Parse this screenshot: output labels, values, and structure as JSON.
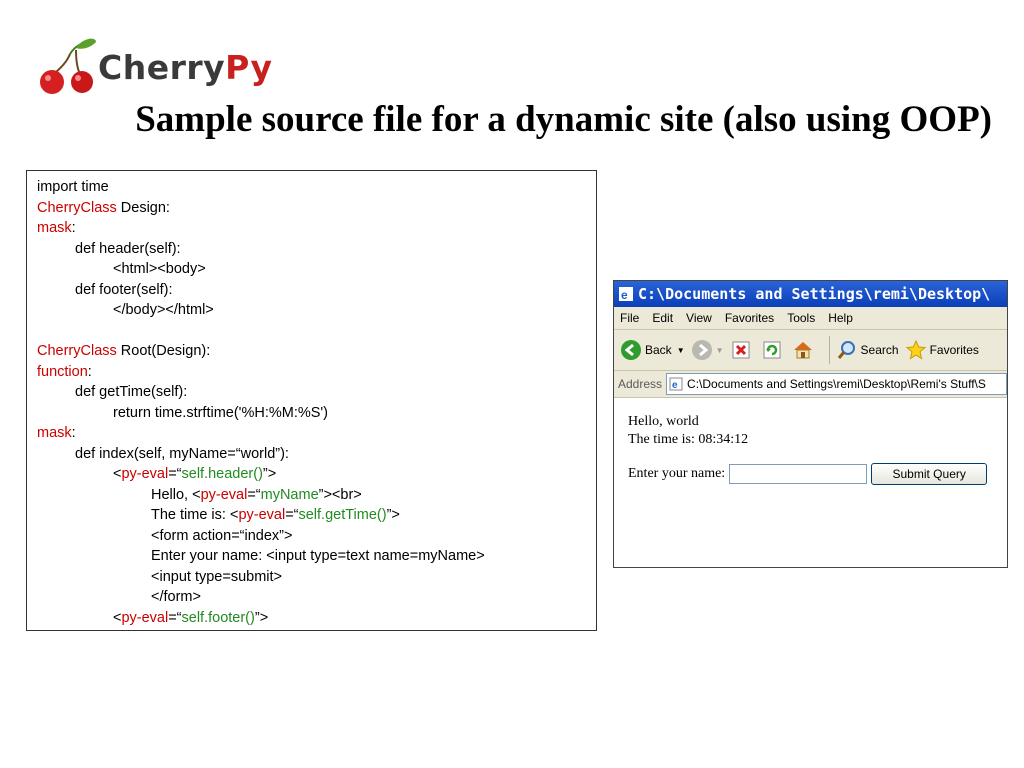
{
  "logo": {
    "cherry_text": "Cherry",
    "py_text": "Py"
  },
  "slide": {
    "title": "Sample source file for a dynamic site (also using OOP)"
  },
  "code": {
    "l1": "import time",
    "l2_kw": "CherryClass",
    "l2_rest": " Design:",
    "l3_kw": "mask",
    "l3_rest": ":",
    "l4": "def header(self):",
    "l5": "<html><body>",
    "l6": "def footer(self):",
    "l7": "</body></html>",
    "l9_kw": "CherryClass",
    "l9_rest": " Root(Design):",
    "l10_kw": "function",
    "l10_rest": ":",
    "l11": "def getTime(self):",
    "l12": "return time.strftime('%H:%M:%S')",
    "l13_kw": "mask",
    "l13_rest": ":",
    "l14": "def index(self, myName=“world”):",
    "l15_a": "<",
    "l15_kw": "py-eval",
    "l15_b": "=“",
    "l15_str": "self.header()",
    "l15_c": "”>",
    "l16_a": "Hello, <",
    "l16_kw": "py-eval",
    "l16_b": "=“",
    "l16_str": "myName",
    "l16_c": "”><br>",
    "l17_a": "The time is: <",
    "l17_kw": "py-eval",
    "l17_b": "=“",
    "l17_str": "self.getTime()",
    "l17_c": "”>",
    "l18": "<form action=“index”>",
    "l19": "Enter your name: <input type=text name=myName>",
    "l20": "<input type=submit>",
    "l21": "</form>",
    "l22_a": "<",
    "l22_kw": "py-eval",
    "l22_b": "=“",
    "l22_str": "self.footer()",
    "l22_c": "”>"
  },
  "browser": {
    "title": "C:\\Documents and Settings\\remi\\Desktop\\",
    "menu": [
      "File",
      "Edit",
      "View",
      "Favorites",
      "Tools",
      "Help"
    ],
    "back_label": "Back",
    "search_label": "Search",
    "favorites_label": "Favorites",
    "address_label": "Address",
    "address_value": "C:\\Documents and Settings\\remi\\Desktop\\Remi's Stuff\\S",
    "content": {
      "line1": "Hello, world",
      "line2": "The time is: 08:34:12",
      "form_label": "Enter your name:",
      "submit_label": "Submit Query"
    }
  },
  "colors": {
    "keyword": "#cc0000",
    "string": "#228b22",
    "titlebar": "#0a3fb8"
  }
}
